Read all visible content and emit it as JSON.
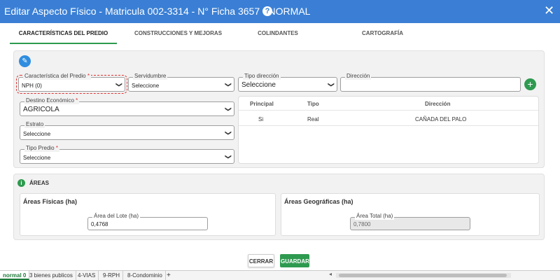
{
  "window": {
    "title": "Editar Aspecto Físico - Matricula 002-3314 - N° Ficha 3657 - NORMAL",
    "help_icon": "?",
    "close_icon": "✕"
  },
  "tabs": [
    {
      "label": "CARACTERÍSTICAS DEL PREDIO",
      "active": true
    },
    {
      "label": "CONSTRUCCIONES Y MEJORAS",
      "active": false
    },
    {
      "label": "COLINDANTES",
      "active": false
    },
    {
      "label": "CARTOGRAFÍA",
      "active": false
    }
  ],
  "predio": {
    "edit_icon": "✎",
    "caracteristica": {
      "label": "Característica del Predio",
      "required": "*",
      "value": "NPH (0)"
    },
    "servidumbre": {
      "label": "Servidumbre",
      "value": "Seleccione"
    },
    "tipo_direccion": {
      "label": "Tipo dirección",
      "value": "Seleccione"
    },
    "direccion": {
      "label": "Dirección",
      "value": ""
    },
    "add_icon": "+",
    "destino": {
      "label": "Destino Económico",
      "required": "*",
      "value": "AGRICOLA"
    },
    "estrato": {
      "label": "Estrato",
      "value": "Seleccione"
    },
    "tipo_predio": {
      "label": "Tipo Predio",
      "required": "*",
      "value": "Seleccione"
    },
    "chevron": "❯"
  },
  "address_table": {
    "headers": [
      "Principal",
      "Tipo",
      "Dirección"
    ],
    "rows": [
      [
        "Si",
        "Real",
        "CAÑADA DEL PALO"
      ]
    ]
  },
  "areas": {
    "section_title": "ÁREAS",
    "info_icon": "i",
    "fisicas": {
      "title": "Áreas Físicas (ha)",
      "field_label": "Área del Lote (ha)",
      "value": "0,4768"
    },
    "geograficas": {
      "title": "Áreas Geográficas (ha)",
      "field_label": "Área Total (ha)",
      "value": "0,7800"
    }
  },
  "buttons": {
    "cerrar": "CERRAR",
    "guardar": "GUARDAR"
  },
  "sheets": [
    "normal 0",
    "3 bienes publicos",
    "4-VIAS",
    "9-RPH",
    "8-Condominio"
  ],
  "sheet_add": "+",
  "scroll_arrow": "◂",
  "colors": {
    "accent": "#3a7fd5",
    "success": "#2e9a4f",
    "required": "#d33"
  }
}
